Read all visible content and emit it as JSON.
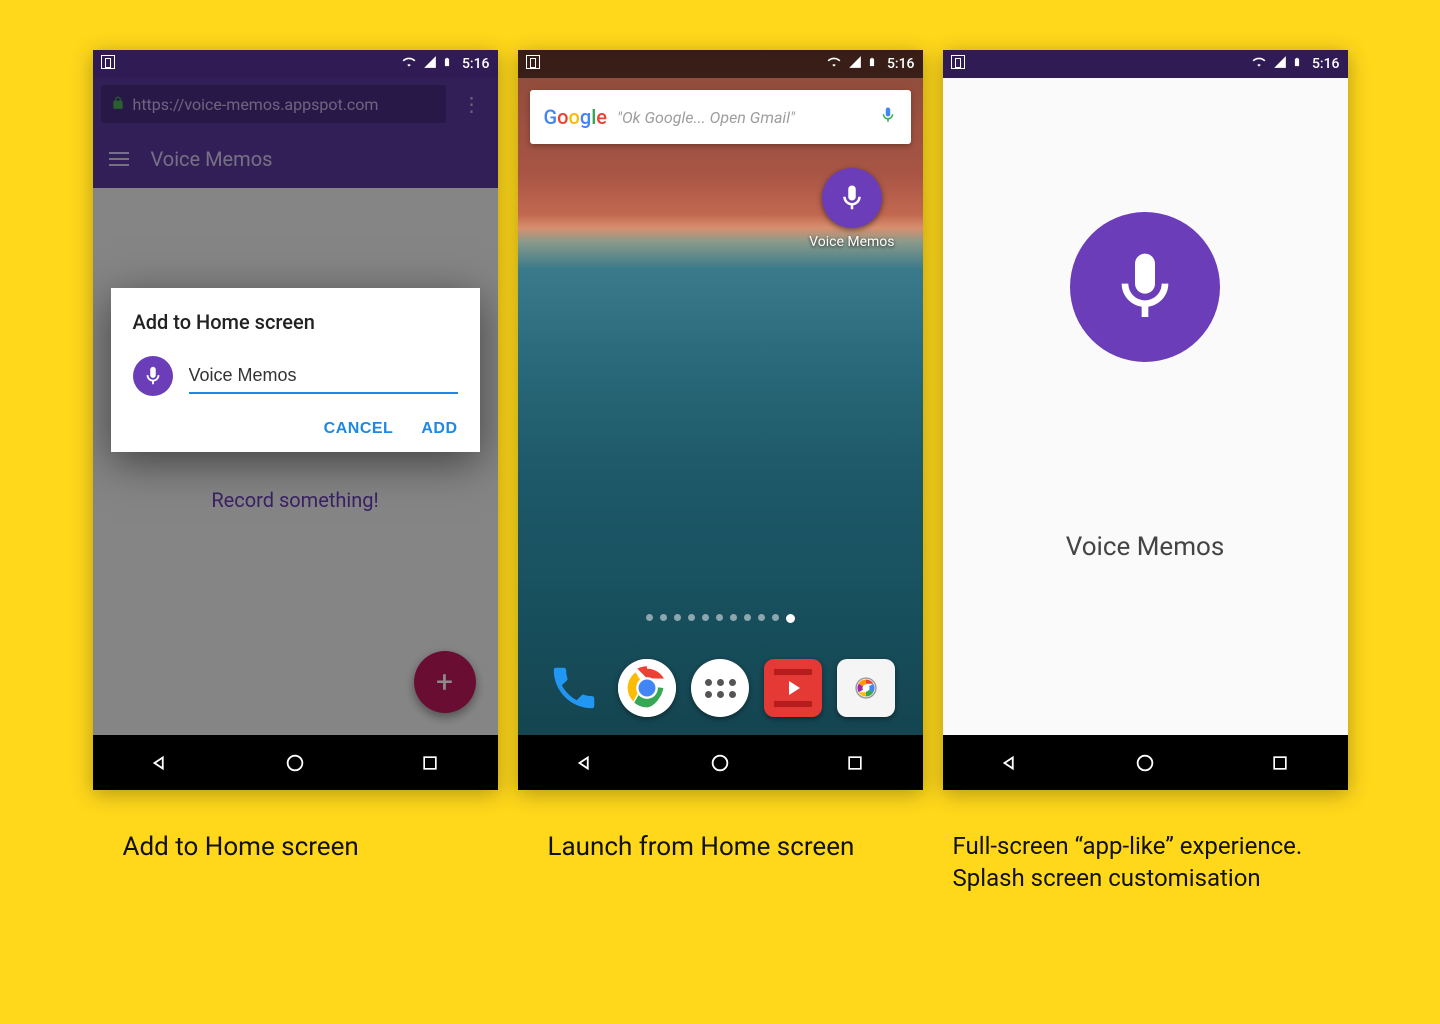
{
  "status": {
    "time": "5:16"
  },
  "phone1": {
    "url": "https://voice-memos.appspot.com",
    "app_title": "Voice Memos",
    "record_prompt": "Record something!",
    "dialog": {
      "title": "Add to Home screen",
      "input_value": "Voice Memos",
      "cancel": "CANCEL",
      "add": "ADD"
    }
  },
  "phone2": {
    "search_placeholder": "\"Ok Google... Open Gmail\"",
    "app_icon_label": "Voice Memos"
  },
  "phone3": {
    "splash_title": "Voice Memos"
  },
  "captions": {
    "c1": "Add to Home screen",
    "c2": "Launch from Home screen",
    "c3": "Full-screen “app-like” experience. Splash screen customisation"
  },
  "colors": {
    "accent": "#6c3db8",
    "status_bg": "#311b54",
    "fab": "#c2185b",
    "link": "#1e88e5"
  }
}
